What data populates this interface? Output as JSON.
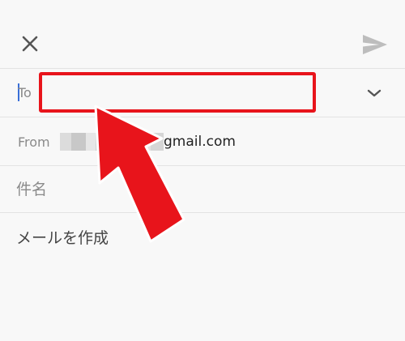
{
  "header": {
    "close_icon": "close-icon",
    "send_icon": "send-icon"
  },
  "compose": {
    "to_label": "To",
    "to_value": "",
    "expand_icon": "chevron-down-icon",
    "from_label": "From",
    "from_address_visible": "gmail.com",
    "subject_placeholder": "件名",
    "body_placeholder": "メールを作成"
  },
  "annotation": {
    "highlight_color": "#e8141b"
  },
  "colors": {
    "background": "#f8f8f8",
    "divider": "#e3e3e3",
    "label": "#8a8a8a",
    "cursor": "#3a6fd8",
    "icon": "#555555",
    "send_icon": "#bdbdbd"
  }
}
